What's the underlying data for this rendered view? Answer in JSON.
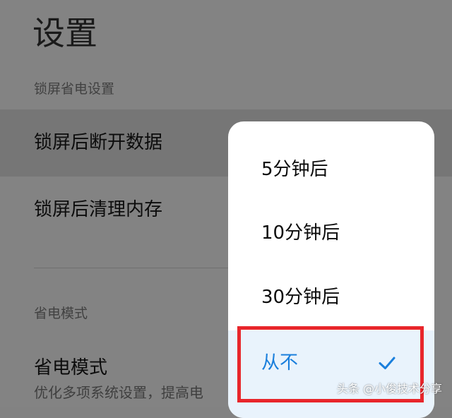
{
  "page": {
    "title": "设置"
  },
  "sections": {
    "lock_screen_header": "锁屏省电设置",
    "power_mode_header": "省电模式"
  },
  "rows": {
    "disconnect_data_label": "锁屏后断开数据",
    "clear_memory_label": "锁屏后清理内存",
    "power_saving_label": "省电模式",
    "power_saving_subtitle": "优化多项系统设置，提高电"
  },
  "popup": {
    "options": [
      {
        "label": "5分钟后",
        "selected": false
      },
      {
        "label": "10分钟后",
        "selected": false
      },
      {
        "label": "30分钟后",
        "selected": false
      },
      {
        "label": "从不",
        "selected": true
      }
    ],
    "check_icon": "check-icon",
    "accent_color": "#1a7fdc"
  },
  "annotation": {
    "highlight_color": "#e8262b"
  },
  "watermark": "头条 @小俊技术分享"
}
